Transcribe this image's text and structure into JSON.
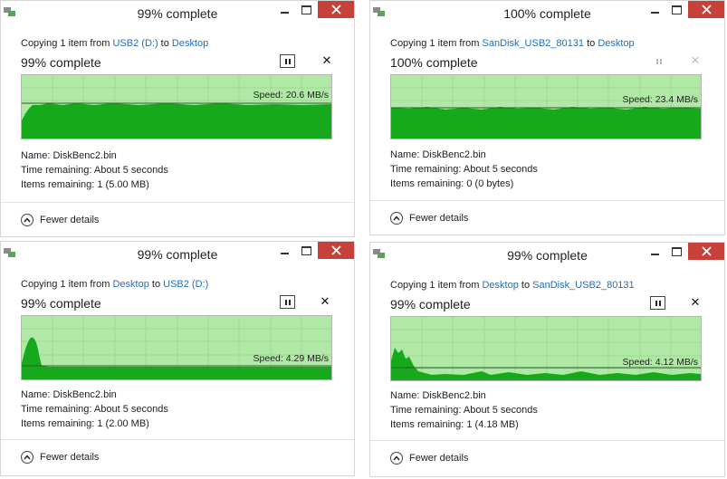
{
  "dialogs": [
    {
      "title": "99% complete",
      "copy_prefix": "Copying 1 item from ",
      "from": "USB2 (D:)",
      "to_word": " to ",
      "to": "Desktop",
      "percent": "99% complete",
      "speed": "Speed: 20.6 MB/s",
      "name_line": "Name:  DiskBenc2.bin",
      "time_line": "Time remaining:  About 5 seconds",
      "items_line": "Items remaining:  1 (5.00 MB)",
      "fewer_details": "Fewer details",
      "progress": 0.99,
      "controls_enabled": true
    },
    {
      "title": "100% complete",
      "copy_prefix": "Copying 1 item from ",
      "from": "SanDisk_USB2_80131",
      "to_word": " to ",
      "to": "Desktop",
      "percent": "100% complete",
      "speed": "Speed: 23.4 MB/s",
      "name_line": "Name:  DiskBenc2.bin",
      "time_line": "Time remaining:  About 5 seconds",
      "items_line": "Items remaining:  0 (0 bytes)",
      "fewer_details": "Fewer details",
      "progress": 1.0,
      "controls_enabled": false
    },
    {
      "title": "99% complete",
      "copy_prefix": "Copying 1 item from ",
      "from": "Desktop",
      "to_word": " to ",
      "to": "USB2 (D:)",
      "percent": "99% complete",
      "speed": "Speed: 4.29 MB/s",
      "name_line": "Name:  DiskBenc2.bin",
      "time_line": "Time remaining:  About 5 seconds",
      "items_line": "Items remaining:  1 (2.00 MB)",
      "fewer_details": "Fewer details",
      "progress": 0.99,
      "controls_enabled": true
    },
    {
      "title": "99% complete",
      "copy_prefix": "Copying 1 item from ",
      "from": "Desktop",
      "to_word": " to ",
      "to": "SanDisk_USB2_80131",
      "percent": "99% complete",
      "speed": "Speed: 4.12 MB/s",
      "name_line": "Name:  DiskBenc2.bin",
      "time_line": "Time remaining:  About 5 seconds",
      "items_line": "Items remaining:  1 (4.18 MB)",
      "fewer_details": "Fewer details",
      "progress": 0.99,
      "controls_enabled": true
    }
  ],
  "colors": {
    "graph_progress_bg": "#b0e9a5",
    "graph_fill": "#16a91c",
    "close_button": "#c7403a",
    "link": "#1f6fbf"
  },
  "icons": {
    "app": "copy-files-icon",
    "pause": "pause-icon",
    "cancel": "close-icon",
    "fewer": "chevron-up-icon"
  }
}
